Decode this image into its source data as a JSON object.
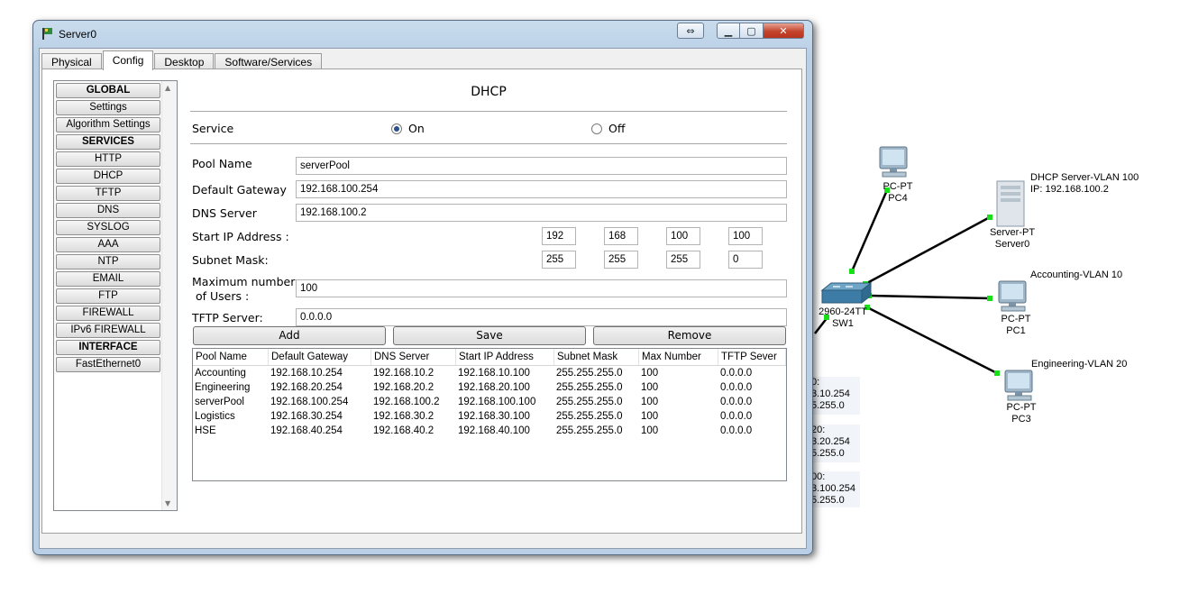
{
  "window": {
    "title": "Server0",
    "swap_glyph": "⇔",
    "minimize_glyph": "▁",
    "maximize_glyph": "▢",
    "close_glyph": "✕"
  },
  "tabs": [
    {
      "label": "Physical",
      "active": false
    },
    {
      "label": "Config",
      "active": true
    },
    {
      "label": "Desktop",
      "active": false
    },
    {
      "label": "Software/Services",
      "active": false
    }
  ],
  "sidebar": {
    "items": [
      {
        "label": "GLOBAL",
        "header": true
      },
      {
        "label": "Settings",
        "header": false
      },
      {
        "label": "Algorithm Settings",
        "header": false
      },
      {
        "label": "SERVICES",
        "header": true
      },
      {
        "label": "HTTP",
        "header": false
      },
      {
        "label": "DHCP",
        "header": false
      },
      {
        "label": "TFTP",
        "header": false
      },
      {
        "label": "DNS",
        "header": false
      },
      {
        "label": "SYSLOG",
        "header": false
      },
      {
        "label": "AAA",
        "header": false
      },
      {
        "label": "NTP",
        "header": false
      },
      {
        "label": "EMAIL",
        "header": false
      },
      {
        "label": "FTP",
        "header": false
      },
      {
        "label": "FIREWALL",
        "header": false
      },
      {
        "label": "IPv6 FIREWALL",
        "header": false
      },
      {
        "label": "INTERFACE",
        "header": true
      },
      {
        "label": "FastEthernet0",
        "header": false
      }
    ]
  },
  "dhcp": {
    "title": "DHCP",
    "service_label": "Service",
    "on_label": "On",
    "off_label": "Off",
    "service_state": "On",
    "pool_name_label": "Pool Name",
    "pool_name": "serverPool",
    "gateway_label": "Default Gateway",
    "gateway": "192.168.100.254",
    "dns_label": "DNS Server",
    "dns": "192.168.100.2",
    "start_ip_label": "Start IP Address :",
    "start_ip": [
      "192",
      "168",
      "100",
      "100"
    ],
    "mask_label": "Subnet Mask:",
    "mask": [
      "255",
      "255",
      "255",
      "0"
    ],
    "max_users_label_1": "Maximum number",
    "max_users_label_2": "of Users :",
    "max_users": "100",
    "tftp_label": "TFTP Server:",
    "tftp": "0.0.0.0",
    "add_label": "Add",
    "save_label": "Save",
    "remove_label": "Remove"
  },
  "pool_table": {
    "columns": [
      "Pool Name",
      "Default Gateway",
      "DNS Server",
      "Start IP Address",
      "Subnet Mask",
      "Max Number",
      "TFTP Sever"
    ],
    "rows": [
      [
        "Accounting",
        "192.168.10.254",
        "192.168.10.2",
        "192.168.10.100",
        "255.255.255.0",
        "100",
        "0.0.0.0"
      ],
      [
        "Engineering",
        "192.168.20.254",
        "192.168.20.2",
        "192.168.20.100",
        "255.255.255.0",
        "100",
        "0.0.0.0"
      ],
      [
        "serverPool",
        "192.168.100.254",
        "192.168.100.2",
        "192.168.100.100",
        "255.255.255.0",
        "100",
        "0.0.0.0"
      ],
      [
        "Logistics",
        "192.168.30.254",
        "192.168.30.2",
        "192.168.30.100",
        "255.255.255.0",
        "100",
        "0.0.0.0"
      ],
      [
        "HSE",
        "192.168.40.254",
        "192.168.40.2",
        "192.168.40.100",
        "255.255.255.0",
        "100",
        "0.0.0.0"
      ]
    ]
  },
  "topology": {
    "link_color": "#000000",
    "port_color": "#18e018",
    "pc4": {
      "type": "PC-PT",
      "name": "PC4"
    },
    "server0": {
      "type": "Server-PT",
      "name": "Server0",
      "note_1": "DHCP Server-VLAN 100",
      "note_2": "IP: 192.168.100.2"
    },
    "sw1": {
      "type": "2960-24TT",
      "name": "SW1"
    },
    "pc1": {
      "type": "PC-PT",
      "name": "PC1",
      "note": "Accounting-VLAN 10"
    },
    "pc3": {
      "type": "PC-PT",
      "name": "PC3",
      "note": "Engineering-VLAN 20"
    },
    "vlan_notes": [
      [
        "0:",
        "3.10.254",
        "5.255.0"
      ],
      [
        "20:",
        "3.20.254",
        "5.255.0"
      ],
      [
        "00:",
        "3.100.254",
        "5.255.0"
      ]
    ]
  }
}
